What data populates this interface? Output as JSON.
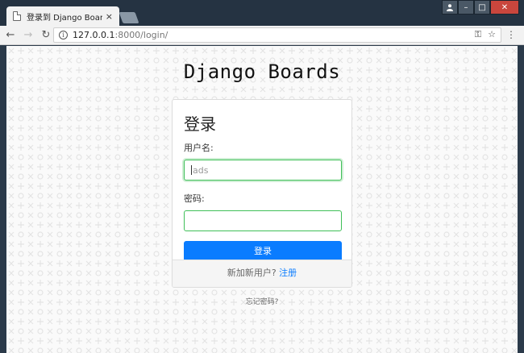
{
  "browser": {
    "tab_title": "登录到 Django Boards",
    "tab_close": "×",
    "url_host": "127.0.0.1",
    "url_path": ":8000/login/",
    "nav": {
      "back": "←",
      "forward": "→",
      "reload": "↻"
    },
    "omni_icons": {
      "key": "⚿",
      "star": "☆"
    },
    "menu": "⋮",
    "window_controls": {
      "user": "👤",
      "minimize": "–",
      "maximize": "□",
      "close": "✕"
    }
  },
  "page": {
    "brand": "Django Boards",
    "card_title": "登录",
    "username_label": "用户名:",
    "username_value": "ads",
    "password_label": "密码:",
    "submit_label": "登录",
    "footer_text": "新加新用户?",
    "footer_link": "注册",
    "forgot_link": "忘记密码?"
  },
  "colors": {
    "primary": "#0a7cff",
    "input_border_focus": "#3fbf58",
    "chrome_dark": "#253342"
  }
}
